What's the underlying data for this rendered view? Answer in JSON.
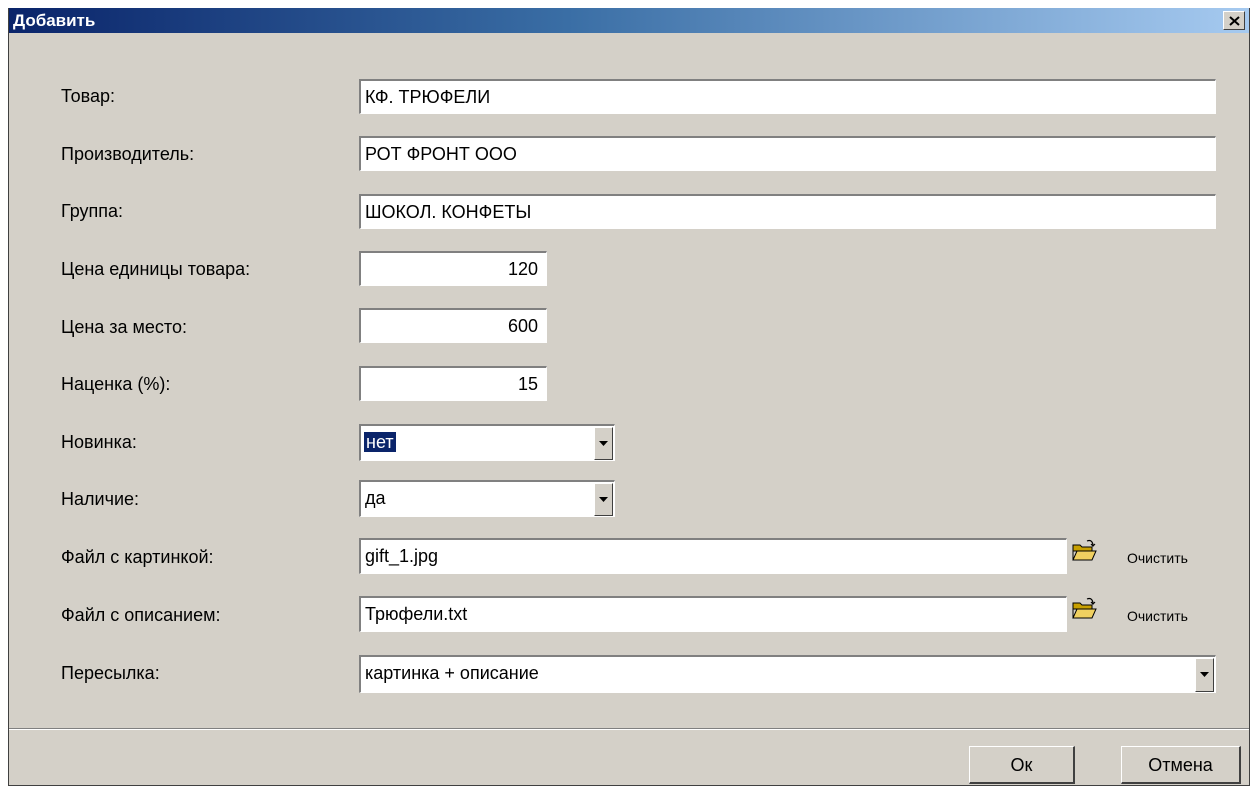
{
  "window": {
    "title": "Добавить"
  },
  "form": {
    "product": {
      "label": "Товар:",
      "value": "КФ. ТРЮФЕЛИ"
    },
    "manufacturer": {
      "label": "Производитель:",
      "value": "РОТ ФРОНТ ООО"
    },
    "group": {
      "label": "Группа:",
      "value": "ШОКОЛ. КОНФЕТЫ"
    },
    "unit_price": {
      "label": "Цена единицы товара:",
      "value": "120"
    },
    "place_price": {
      "label": "Цена за место:",
      "value": "600"
    },
    "markup": {
      "label": "Наценка (%):",
      "value": "15"
    },
    "new_item": {
      "label": "Новинка:",
      "value": "нет"
    },
    "availability": {
      "label": "Наличие:",
      "value": "да"
    },
    "image_file": {
      "label": "Файл с картинкой:",
      "value": "gift_1.jpg",
      "clear_label": "Очистить"
    },
    "description_file": {
      "label": "Файл с описанием:",
      "value": "Трюфели.txt",
      "clear_label": "Очистить"
    },
    "sending": {
      "label": "Пересылка:",
      "value": "картинка + описание"
    }
  },
  "buttons": {
    "ok": "Ок",
    "cancel": "Отмена"
  },
  "colors": {
    "title_start": "#0a246a",
    "title_end": "#a6caf0",
    "face": "#d4d0c8",
    "selection": "#0a246a"
  }
}
